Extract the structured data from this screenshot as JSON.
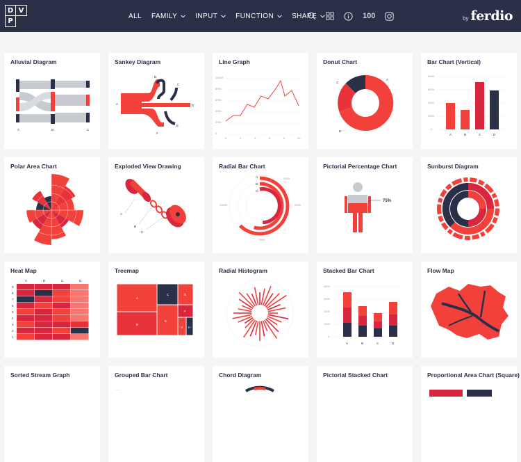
{
  "brand": {
    "logo_letters": [
      "D",
      "V",
      "P"
    ],
    "by": "by",
    "name": "ferdio"
  },
  "nav": {
    "items": [
      {
        "label": "ALL",
        "has_dropdown": false
      },
      {
        "label": "FAMILY",
        "has_dropdown": true
      },
      {
        "label": "INPUT",
        "has_dropdown": true
      },
      {
        "label": "FUNCTION",
        "has_dropdown": true
      },
      {
        "label": "SHAPE",
        "has_dropdown": true
      }
    ],
    "icons": [
      "search-icon",
      "grid-icon",
      "info-icon",
      "100-icon",
      "instagram-icon"
    ],
    "icon_100_text": "100"
  },
  "colors": {
    "navy": "#2b3049",
    "red": "#f2413b",
    "crimson": "#d7263d",
    "grey": "#c8ccd0",
    "bg": "#f3f5f7"
  },
  "cards": [
    {
      "title": "Alluvial Diagram",
      "labels": [
        "A",
        "B",
        "C"
      ]
    },
    {
      "title": "Sankey Diagram",
      "labels": [
        "A",
        "B",
        "C",
        "D",
        "E",
        "F"
      ]
    },
    {
      "title": "Line Graph",
      "y_ticks": [
        "10000",
        "8000",
        "6000",
        "4000",
        "2000",
        "0"
      ],
      "x_ticks": [
        "0",
        "2",
        "4",
        "6",
        "8",
        "10"
      ]
    },
    {
      "title": "Donut Chart",
      "labels": [
        "A",
        "B",
        "C"
      ]
    },
    {
      "title": "Bar Chart (Vertical)",
      "labels": [
        "A",
        "B",
        "C",
        "D"
      ],
      "y_ticks": [
        "8000",
        "6000",
        "4000",
        "2000",
        "0"
      ]
    },
    {
      "title": "Polar Area Chart"
    },
    {
      "title": "Exploded View Drawing",
      "labels": [
        "A",
        "B",
        "C"
      ]
    },
    {
      "title": "Radial Bar Chart",
      "labels": [
        "A",
        "B",
        "C"
      ],
      "ticks": [
        "2500",
        "5000",
        "7500",
        "10000"
      ]
    },
    {
      "title": "Pictorial Percentage Chart",
      "value": "75%"
    },
    {
      "title": "Sunburst Diagram"
    },
    {
      "title": "Heat Map",
      "cols": [
        "A",
        "B",
        "C",
        "D"
      ],
      "rows": [
        "9",
        "8",
        "7",
        "6",
        "5",
        "4",
        "3",
        "2",
        "1"
      ]
    },
    {
      "title": "Treemap",
      "labels": [
        "A",
        "B",
        "C",
        "D",
        "E",
        "F",
        "G",
        "H"
      ]
    },
    {
      "title": "Radial Histogram"
    },
    {
      "title": "Stacked Bar Chart",
      "labels": [
        "A",
        "B",
        "C",
        "D"
      ],
      "y_ticks": [
        "4000",
        "3000",
        "2000",
        "1000",
        "0"
      ]
    },
    {
      "title": "Flow Map"
    },
    {
      "title": "Sorted Stream Graph"
    },
    {
      "title": "Grouped Bar Chart"
    },
    {
      "title": "Chord Diagram"
    },
    {
      "title": "Pictorial Stacked Chart"
    },
    {
      "title": "Proportional Area Chart (Square)"
    }
  ]
}
